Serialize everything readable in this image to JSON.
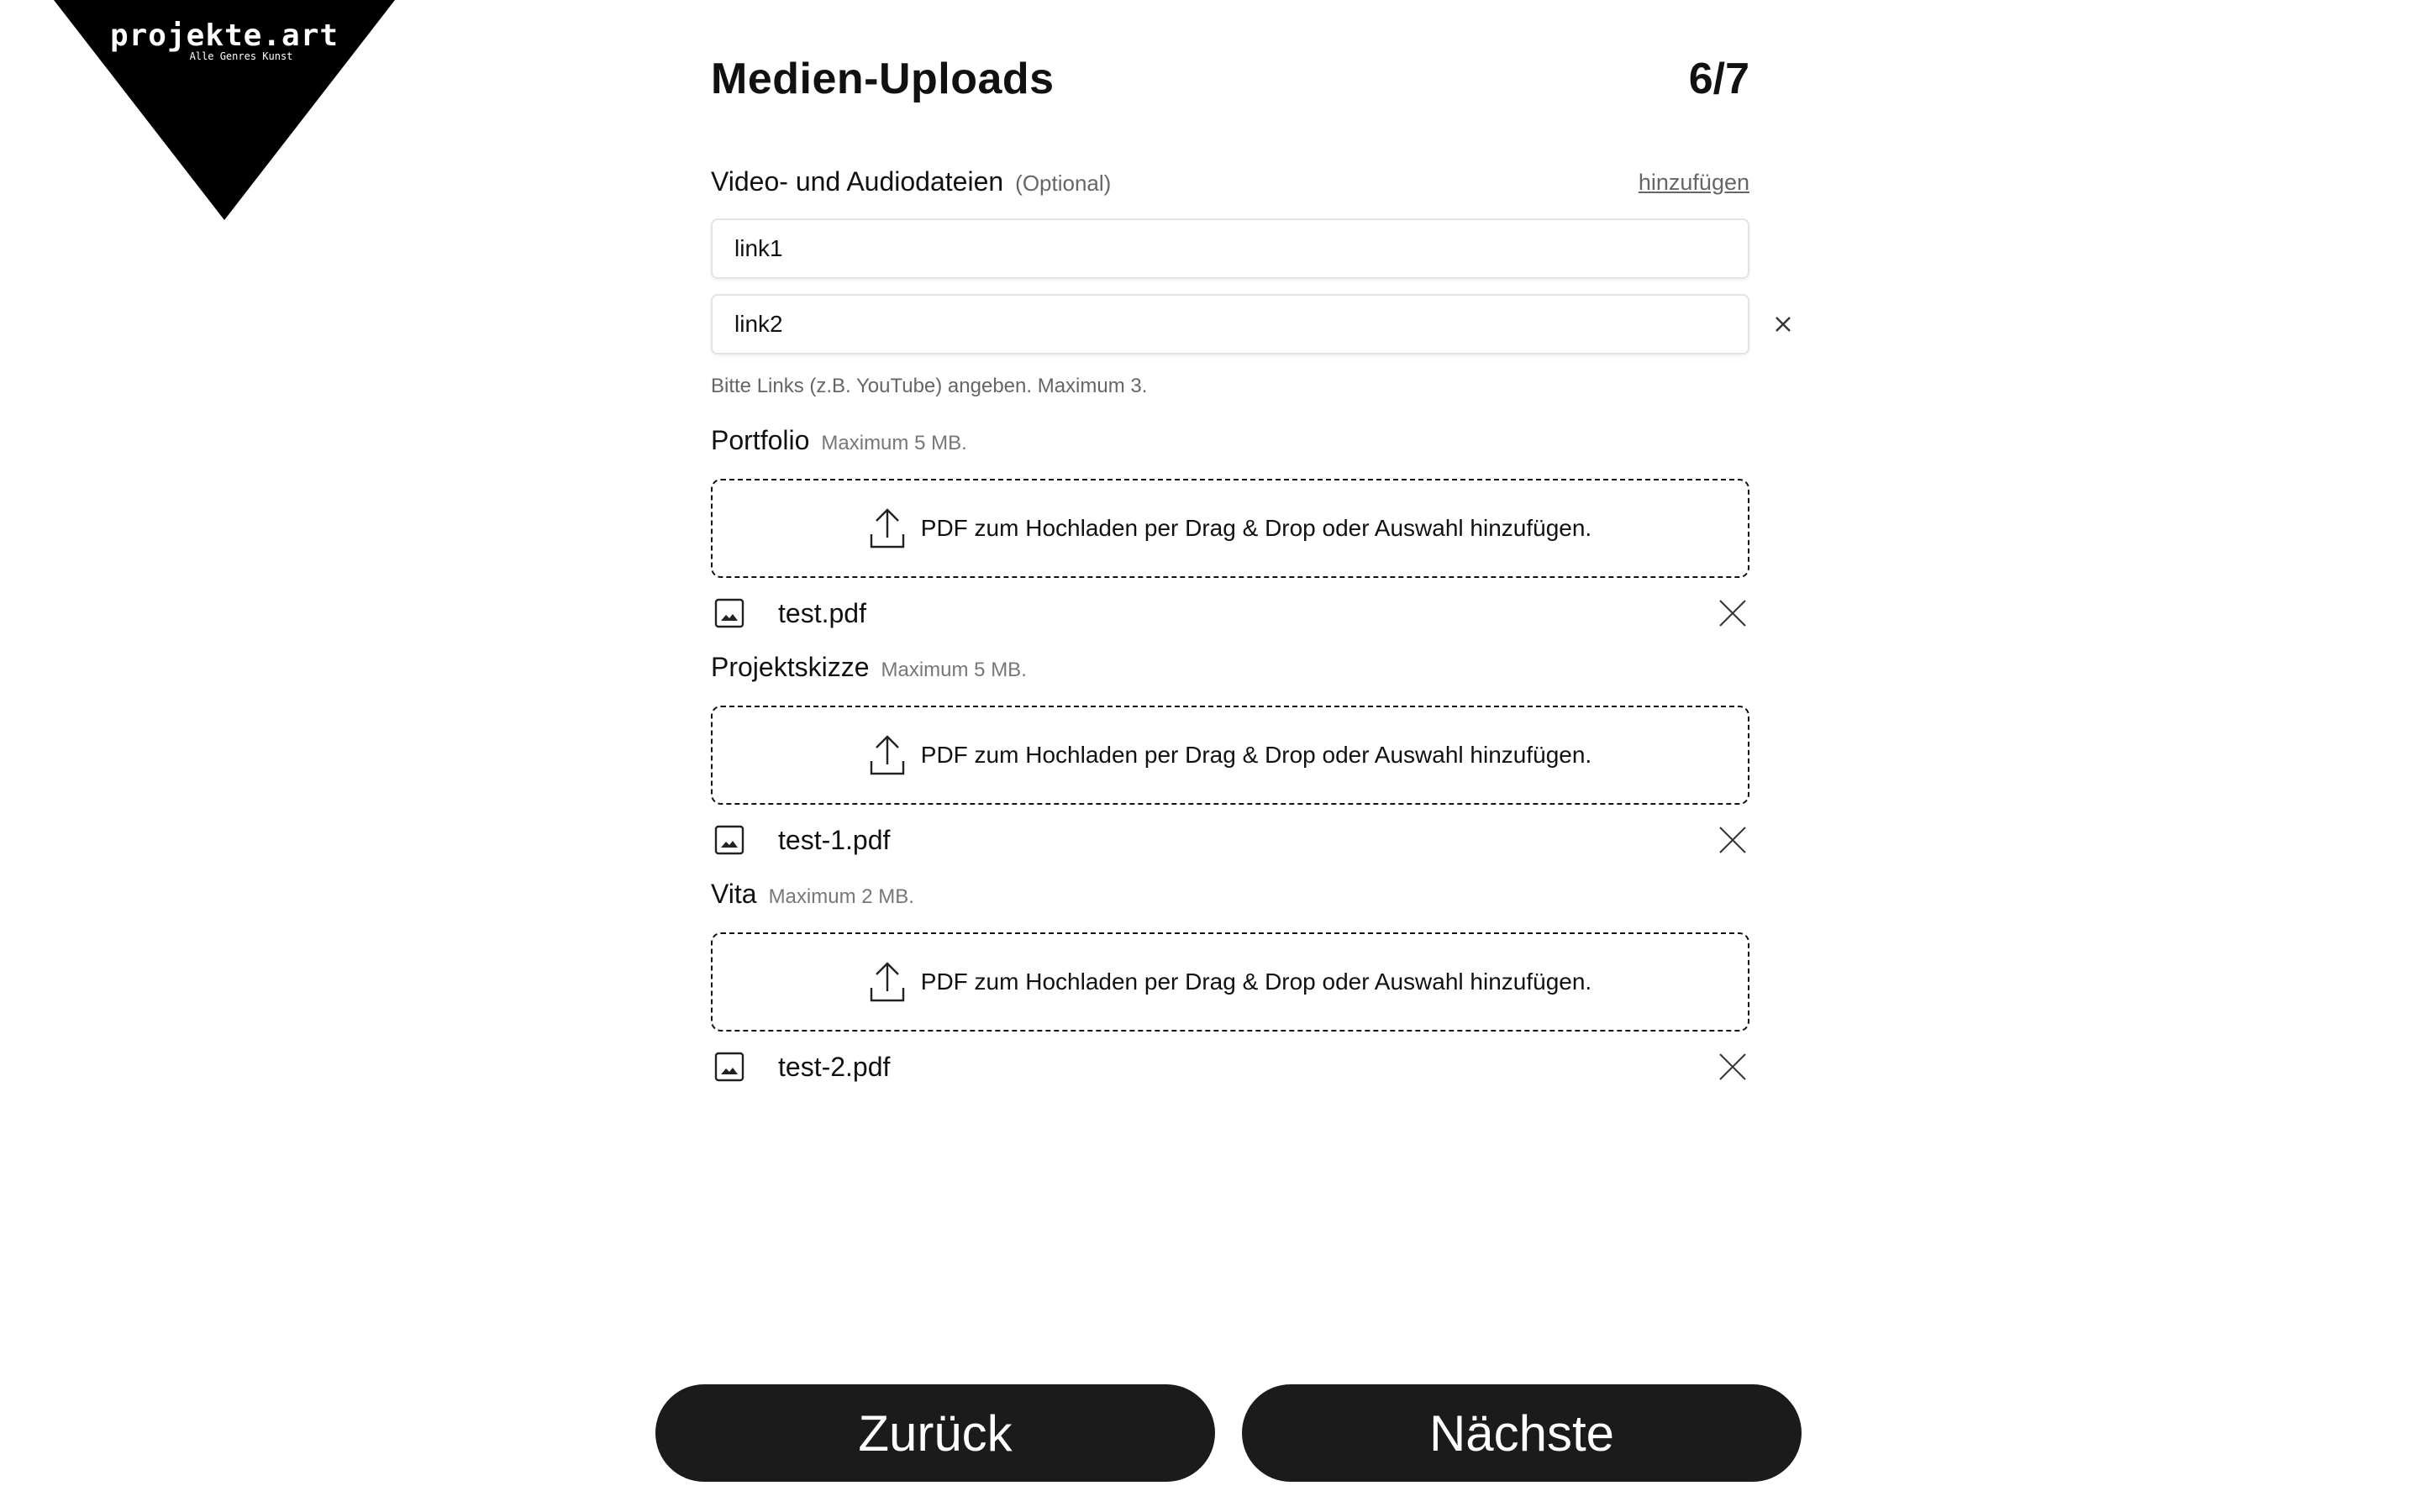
{
  "brand": {
    "name": "projekte.art",
    "tagline": "Alle Genres Kunst"
  },
  "header": {
    "title": "Medien-Uploads",
    "step": "6/7"
  },
  "media_links": {
    "label": "Video- und Audiodateien",
    "optional": "(Optional)",
    "add_label": "hinzufügen",
    "inputs": [
      {
        "value": "link1"
      },
      {
        "value": "link2"
      }
    ],
    "hint": "Bitte Links (z.B. YouTube) angeben. Maximum 3."
  },
  "uploads": [
    {
      "label": "Portfolio",
      "limit": "Maximum 5 MB.",
      "dropzone_text": "PDF zum Hochladen per Drag & Drop oder Auswahl hinzufügen.",
      "file": "test.pdf"
    },
    {
      "label": "Projektskizze",
      "limit": "Maximum 5 MB.",
      "dropzone_text": "PDF zum Hochladen per Drag & Drop oder Auswahl hinzufügen.",
      "file": "test-1.pdf"
    },
    {
      "label": "Vita",
      "limit": "Maximum 2 MB.",
      "dropzone_text": "PDF zum Hochladen per Drag & Drop oder Auswahl hinzufügen.",
      "file": "test-2.pdf"
    }
  ],
  "footer": {
    "back_label": "Zurück",
    "next_label": "Nächste"
  },
  "icons": {
    "upload": "upload-icon",
    "image": "image-icon",
    "close": "close-icon"
  }
}
